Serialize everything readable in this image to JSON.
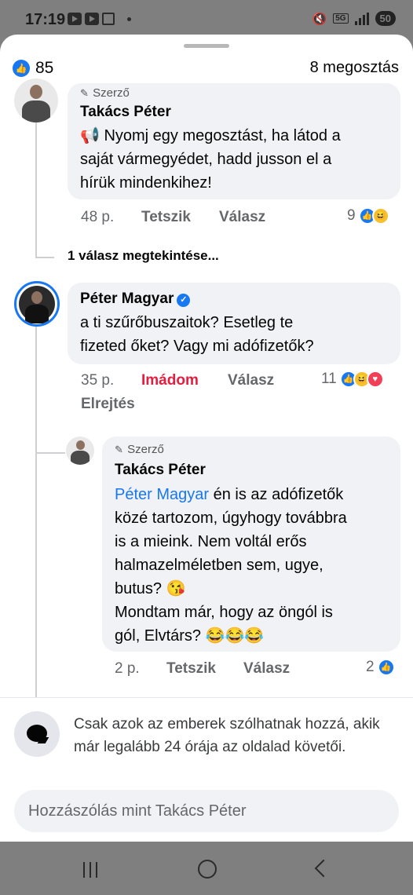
{
  "status_bar": {
    "time": "17:19",
    "battery": "50",
    "network": "5G"
  },
  "header": {
    "like_count": "85",
    "share_count": "8 megosztás"
  },
  "comments": [
    {
      "badge": "Szerző",
      "name": "Takács Péter",
      "text_lines": [
        "📢 Nyomj egy megosztást, ha látod a",
        "saját vármegyédet, hadd jusson el a",
        "hírük mindenkihez!"
      ],
      "time": "48 p.",
      "like_label": "Tetszik",
      "reply_label": "Válasz",
      "reaction_count": "9",
      "view_replies": "1 válasz megtekintése..."
    },
    {
      "name": "Péter Magyar",
      "text_lines": [
        "a ti szűrőbuszaitok? Esetleg te",
        "fizeted őket? Vagy mi adófizetők?"
      ],
      "time": "35 p.",
      "like_label": "Imádom",
      "reply_label": "Válasz",
      "reaction_count": "11",
      "hide_label": "Elrejtés"
    },
    {
      "badge": "Szerző",
      "name": "Takács Péter",
      "mention": "Péter Magyar",
      "text_lines": [
        " én is az adófizetők",
        "közé tartozom, úgyhogy továbbra",
        "is a mieink. Nem voltál erős",
        "halmazelméletben sem, ugye,",
        "butus? 😘",
        "Mondtam már, hogy az öngól is",
        "gól, Elvtárs? 😂😂😂"
      ],
      "time": "2 p.",
      "like_label": "Tetszik",
      "reply_label": "Válasz",
      "reaction_count": "2"
    }
  ],
  "footer": {
    "notice": "Csak azok az emberek szólhatnak hozzá, akik már legalább 24 órája az oldalad követői.",
    "input_placeholder": "Hozzászólás mint Takács Péter"
  },
  "colors": {
    "facebook_blue": "#1877f2",
    "love_red": "#e41e3f",
    "bubble_gray": "#f0f2f5",
    "meta_gray": "#65676b"
  }
}
